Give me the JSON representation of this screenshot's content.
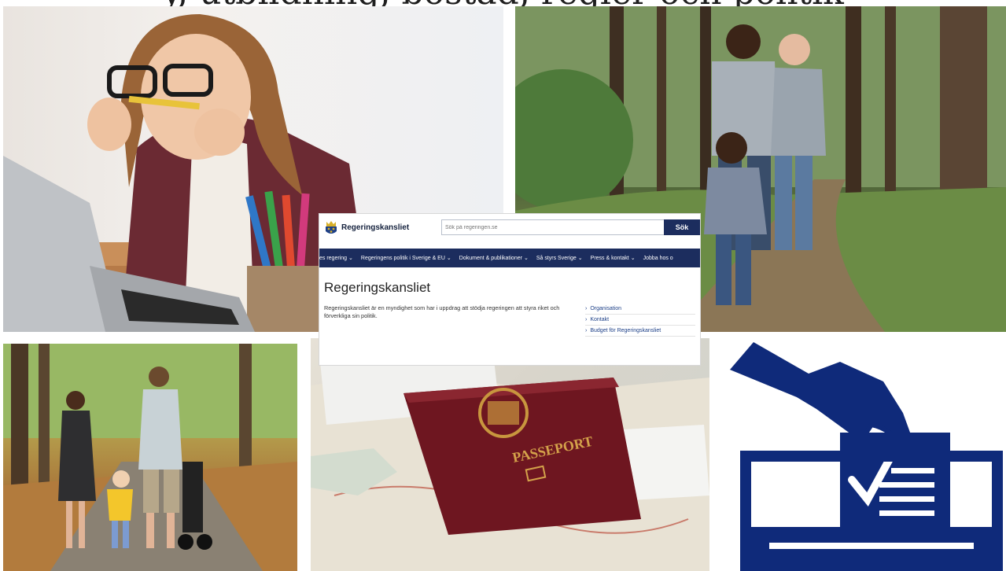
{
  "heading_clipped": "y, utbildning, bostad, regler och politik",
  "website": {
    "brand": "Regeringskansliet",
    "search_placeholder": "Sök på regeringen.se",
    "search_button": "Sök",
    "nav_items": [
      {
        "label": "es regering"
      },
      {
        "label": "Regeringens politik i Sverige & EU"
      },
      {
        "label": "Dokument & publikationer"
      },
      {
        "label": "Så styrs Sverige"
      },
      {
        "label": "Press & kontakt"
      },
      {
        "label": "Jobba hos o"
      }
    ],
    "title": "Regeringskansliet",
    "description": "Regeringskansliet är en myndighet som har i uppdrag att stödja regeringen att styra riket och förverkliga sin politik.",
    "links": [
      {
        "label": "Organisation"
      },
      {
        "label": "Kontakt"
      },
      {
        "label": "Budget för Regeringskansliet"
      }
    ]
  },
  "passport_text": "PASSEPORT",
  "colors": {
    "navy": "#1c2d5e",
    "vote_blue": "#0f2a7a",
    "link_blue": "#1c3f87"
  }
}
